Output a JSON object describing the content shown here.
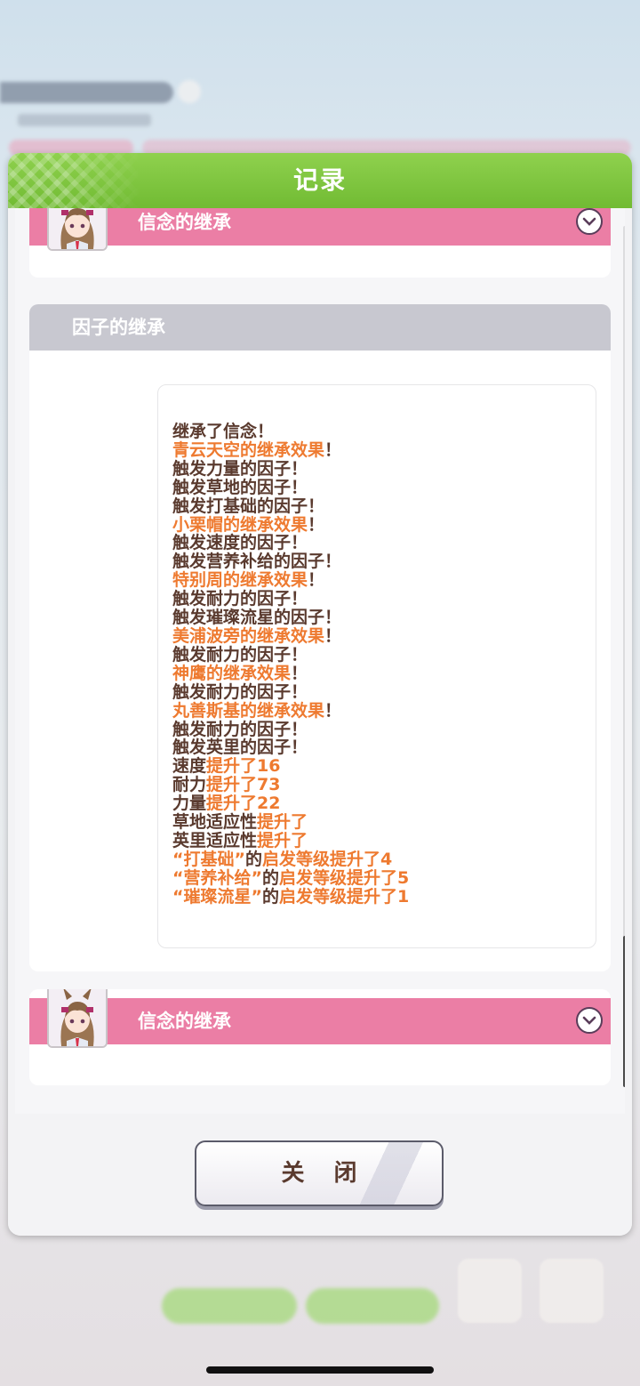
{
  "dialog": {
    "title": "记录",
    "close_label": "关 闭"
  },
  "sections": {
    "top_card_label": "信念的继承",
    "factor_header": "因子的继承",
    "bottom_card_label": "信念的继承"
  },
  "log": [
    [
      {
        "t": "继承了信念！",
        "c": "b"
      }
    ],
    [
      {
        "t": "青云天空的继承效果",
        "c": "o"
      },
      {
        "t": "！",
        "c": "b"
      }
    ],
    [
      {
        "t": "触发力量的因子！",
        "c": "b"
      }
    ],
    [
      {
        "t": "触发草地的因子！",
        "c": "b"
      }
    ],
    [
      {
        "t": "触发打基础的因子！",
        "c": "b"
      }
    ],
    [
      {
        "t": "小栗帽的继承效果",
        "c": "o"
      },
      {
        "t": "！",
        "c": "b"
      }
    ],
    [
      {
        "t": "触发速度的因子！",
        "c": "b"
      }
    ],
    [
      {
        "t": "触发营养补给的因子！",
        "c": "b"
      }
    ],
    [
      {
        "t": "特别周的继承效果",
        "c": "o"
      },
      {
        "t": "！",
        "c": "b"
      }
    ],
    [
      {
        "t": "触发耐力的因子！",
        "c": "b"
      }
    ],
    [
      {
        "t": "触发璀璨流星的因子！",
        "c": "b"
      }
    ],
    [
      {
        "t": "美浦波旁的继承效果",
        "c": "o"
      },
      {
        "t": "！",
        "c": "b"
      }
    ],
    [
      {
        "t": "触发耐力的因子！",
        "c": "b"
      }
    ],
    [
      {
        "t": "神鹰的继承效果",
        "c": "o"
      },
      {
        "t": "！",
        "c": "b"
      }
    ],
    [
      {
        "t": "触发耐力的因子！",
        "c": "b"
      }
    ],
    [
      {
        "t": "丸善斯基的继承效果",
        "c": "o"
      },
      {
        "t": "！",
        "c": "b"
      }
    ],
    [
      {
        "t": "触发耐力的因子！",
        "c": "b"
      }
    ],
    [
      {
        "t": "触发英里的因子！",
        "c": "b"
      }
    ],
    [
      {
        "t": "速度",
        "c": "b"
      },
      {
        "t": "提升了16",
        "c": "o"
      }
    ],
    [
      {
        "t": "耐力",
        "c": "b"
      },
      {
        "t": "提升了73",
        "c": "o"
      }
    ],
    [
      {
        "t": "力量",
        "c": "b"
      },
      {
        "t": "提升了22",
        "c": "o"
      }
    ],
    [
      {
        "t": "草地适应性",
        "c": "b"
      },
      {
        "t": "提升了",
        "c": "o"
      }
    ],
    [
      {
        "t": "英里适应性",
        "c": "b"
      },
      {
        "t": "提升了",
        "c": "o"
      }
    ],
    [
      {
        "t": "“打基础”",
        "c": "o"
      },
      {
        "t": "的",
        "c": "b"
      },
      {
        "t": "启发等级提升了4",
        "c": "o"
      }
    ],
    [
      {
        "t": "“营养补给”",
        "c": "o"
      },
      {
        "t": "的",
        "c": "b"
      },
      {
        "t": "启发等级提升了5",
        "c": "o"
      }
    ],
    [
      {
        "t": "“璀璨流星”",
        "c": "o"
      },
      {
        "t": "的",
        "c": "b"
      },
      {
        "t": "启发等级提升了1",
        "c": "o"
      }
    ]
  ],
  "icons": {
    "chevron": "chevron-down-icon",
    "avatar": "character-avatar"
  },
  "colors": {
    "header_green": "#7cc43e",
    "pink_bar": "#eb7ea5",
    "orange_text": "#ee7a30",
    "brown_text": "#5a3a2e"
  }
}
